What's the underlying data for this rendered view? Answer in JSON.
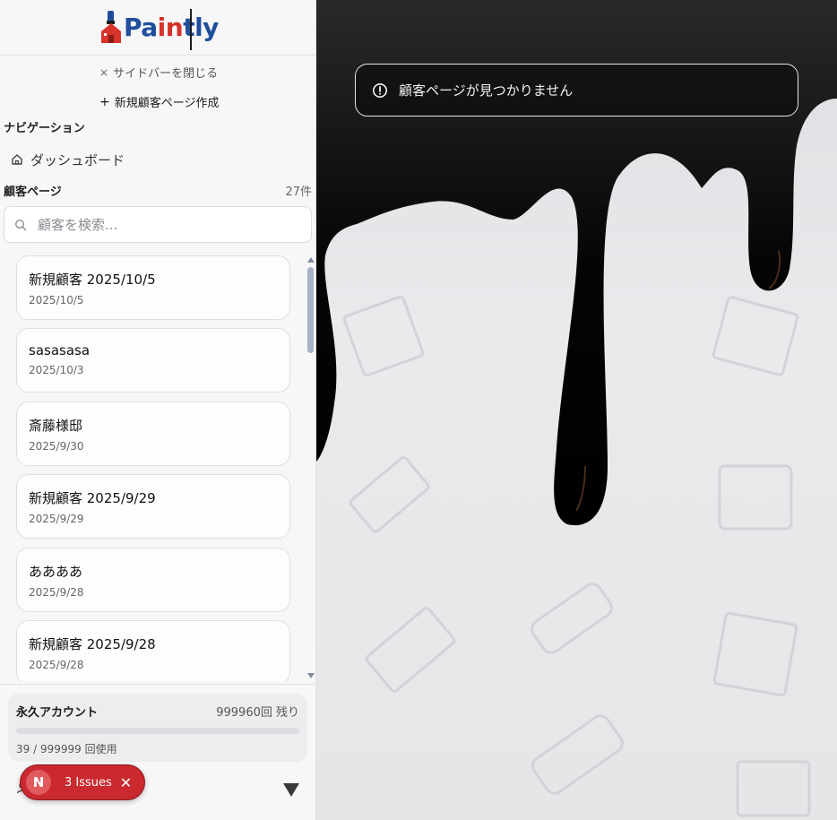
{
  "app": {
    "logo_text_a": "Pa",
    "logo_text_b": "in",
    "logo_text_c": "tly"
  },
  "sidebar": {
    "close_label": "サイドバーを閉じる",
    "new_label": "新規顧客ページ作成",
    "nav_title": "ナビゲーション",
    "dashboard_label": "ダッシュボード",
    "customers_title": "顧客ページ",
    "customers_count": "27件",
    "search_placeholder": "顧客を検索...",
    "customers": [
      {
        "name": "新規顧客 2025/10/5",
        "date": "2025/10/5"
      },
      {
        "name": "sasasasa",
        "date": "2025/10/3"
      },
      {
        "name": "斎藤様邸",
        "date": "2025/9/30"
      },
      {
        "name": "新規顧客 2025/9/29",
        "date": "2025/9/29"
      },
      {
        "name": "ああああ",
        "date": "2025/9/28"
      },
      {
        "name": "新規顧客 2025/9/28",
        "date": "2025/9/28"
      }
    ],
    "account": {
      "name": "永久アカウント",
      "remaining": "999960回 残り",
      "usage": "39 / 999999 回使用",
      "usage_fraction": 3.9e-05
    }
  },
  "issues": {
    "badge": "N",
    "label": "3 Issues",
    "close": "✕"
  },
  "main": {
    "alert_text": "顧客ページが見つかりません"
  },
  "colors": {
    "brand_blue": "#1f4e9c",
    "brand_red": "#d7332a",
    "issues_red": "#c9292f"
  },
  "icons": [
    "close-icon",
    "plus-icon",
    "home-icon",
    "search-icon",
    "user-icon",
    "alert-circle-icon",
    "triangle-down-icon"
  ]
}
